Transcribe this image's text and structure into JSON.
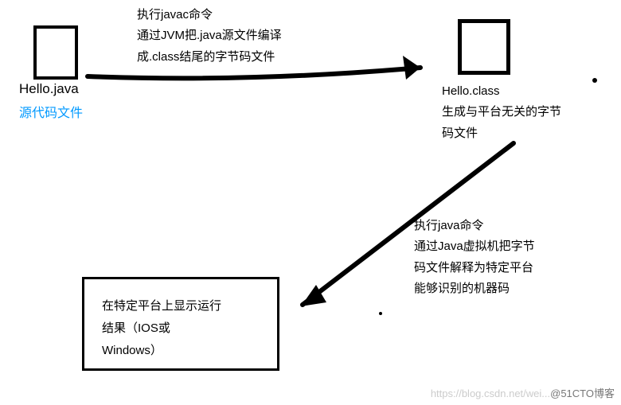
{
  "nodes": {
    "source": {
      "filename": "Hello.java",
      "caption": "源代码文件"
    },
    "bytecode": {
      "filename": "Hello.class",
      "caption_l1": "生成与平台无关的字节",
      "caption_l2": "码文件"
    },
    "result": {
      "line1": "在特定平台上显示运行",
      "line2": "结果（IOS或",
      "line3": "Windows）"
    }
  },
  "edges": {
    "compile": {
      "l1": "执行javac命令",
      "l2": "通过JVM把.java源文件编译",
      "l3": "成.class结尾的字节码文件"
    },
    "run": {
      "l1": "执行java命令",
      "l2": "通过Java虚拟机把字节",
      "l3": "码文件解释为特定平台",
      "l4": "能够识别的机器码"
    }
  },
  "watermark": {
    "faded": "https://blog.csdn.net/wei...",
    "visible": "@51CTO博客"
  }
}
